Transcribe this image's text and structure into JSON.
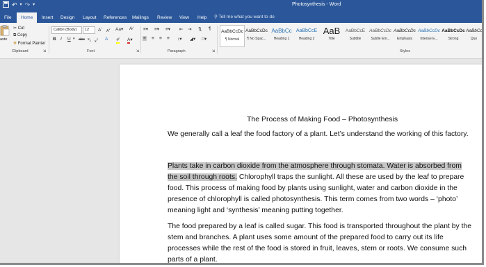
{
  "window": {
    "title": "Photosynthesis - Word"
  },
  "tabs": [
    "File",
    "Home",
    "Insert",
    "Design",
    "Layout",
    "References",
    "Mailings",
    "Review",
    "View",
    "Help"
  ],
  "tell_me": "Tell me what you want to do",
  "clipboard": {
    "paste_label": "aste",
    "cut_label": "Cut",
    "copy_label": "Copy",
    "format_painter_label": "Format Painter",
    "group_label": "Clipboard"
  },
  "font": {
    "family": "Calibri (Body)",
    "size": "12",
    "group_label": "Font"
  },
  "paragraph": {
    "group_label": "Paragraph"
  },
  "styles": {
    "group_label": "Styles",
    "items": [
      {
        "preview": "AaBbCcDc",
        "name": "¶ Normal"
      },
      {
        "preview": "AaBbCcDc",
        "name": "¶ No Spac..."
      },
      {
        "preview": "AaBbCc",
        "name": "Heading 1"
      },
      {
        "preview": "AaBbCcE",
        "name": "Heading 2"
      },
      {
        "preview": "AaB",
        "name": "Title"
      },
      {
        "preview": "AaBbCcE",
        "name": "Subtitle"
      },
      {
        "preview": "AaBbCcDc",
        "name": "Subtle Em..."
      },
      {
        "preview": "AaBbCcDc",
        "name": "Emphasis"
      },
      {
        "preview": "AaBbCcDc",
        "name": "Intense E..."
      },
      {
        "preview": "AaBbCcDc",
        "name": "Strong"
      },
      {
        "preview": "AaBbCc",
        "name": "Quo"
      }
    ]
  },
  "document": {
    "heading": "The Process of Making Food – Photosynthesis",
    "p1": "We generally call a leaf the food factory of a plant. Let’s understand the working of this factory.",
    "p2_highlighted": "Plants take in carbon dioxide from the atmosphere through stomata. Water is absorbed from the soil through roots.",
    "p2_rest": " Chlorophyll traps the sunlight. All these are used by the leaf to prepare food. This process of making food by plants using sunlight, water and carbon dioxide in the presence of chlorophyll is called photosynthesis. This term comes from two words – ‘photo’ meaning light and ‘synthesis’ meaning putting together.",
    "p3": "The food prepared by a leaf is called sugar. This food is transported throughout the plant by the stem and branches. A plant uses some amount of the prepared food to carry out its life processes while the rest of the food is stored in fruit, leaves, stem or roots. We consume such parts of a plant."
  },
  "colors": {
    "ribbon_blue": "#2b579a",
    "highlight": "#c6c6c6"
  }
}
